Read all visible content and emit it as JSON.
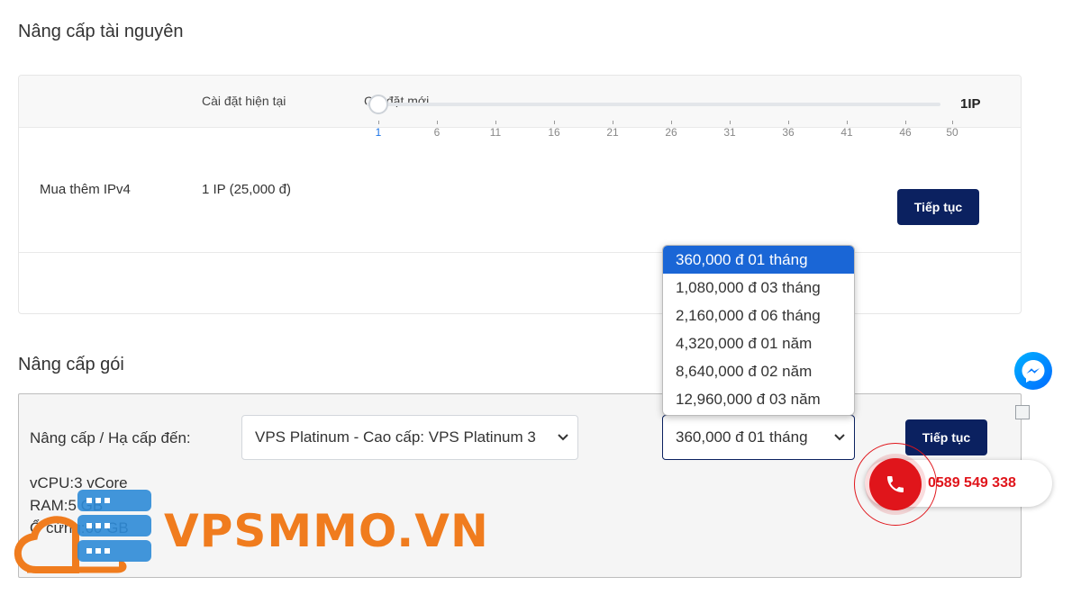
{
  "section1": {
    "title": "Nâng cấp tài nguyên",
    "col_current": "Cài đặt hiện tại",
    "col_new": "Cài đặt mới",
    "row_label": "Mua thêm IPv4",
    "row_current": "1 IP (25,000 đ)",
    "slider": {
      "value": 1,
      "min": 1,
      "max": 50,
      "value_label": "1IP",
      "ticks": [
        "1",
        "6",
        "11",
        "16",
        "21",
        "26",
        "31",
        "36",
        "41",
        "46",
        "50"
      ]
    },
    "button_label": "Tiếp tục"
  },
  "section2": {
    "title": "Nâng cấp gói",
    "label": "Nâng cấp / Hạ cấp đến:",
    "package_select": "VPS Platinum - Cao cấp: VPS Platinum 3",
    "period_select": "360,000 đ 01 tháng",
    "button_label": "Tiếp tục",
    "specs": [
      "vCPU:3 vCore",
      "RAM:5 GB",
      "Ổ cứng:60 GB"
    ]
  },
  "dropdown": {
    "options": [
      "360,000 đ 01 tháng",
      "1,080,000 đ 03 tháng",
      "2,160,000 đ 06 tháng",
      "4,320,000 đ 01 năm",
      "8,640,000 đ 02 năm",
      "12,960,000 đ 03 năm"
    ],
    "selected_index": 0
  },
  "widgets": {
    "phone_number": "0589 549 338",
    "messenger_icon": "messenger-icon",
    "phone_icon": "phone-icon"
  },
  "logo": {
    "text": "VPSMMO.VN"
  },
  "colors": {
    "primary_button": "#0b2160",
    "dropdown_selected": "#1a66d6",
    "phone_red": "#e0151b",
    "logo_orange": "#f07c1e",
    "logo_blue": "#2e8bd8"
  }
}
